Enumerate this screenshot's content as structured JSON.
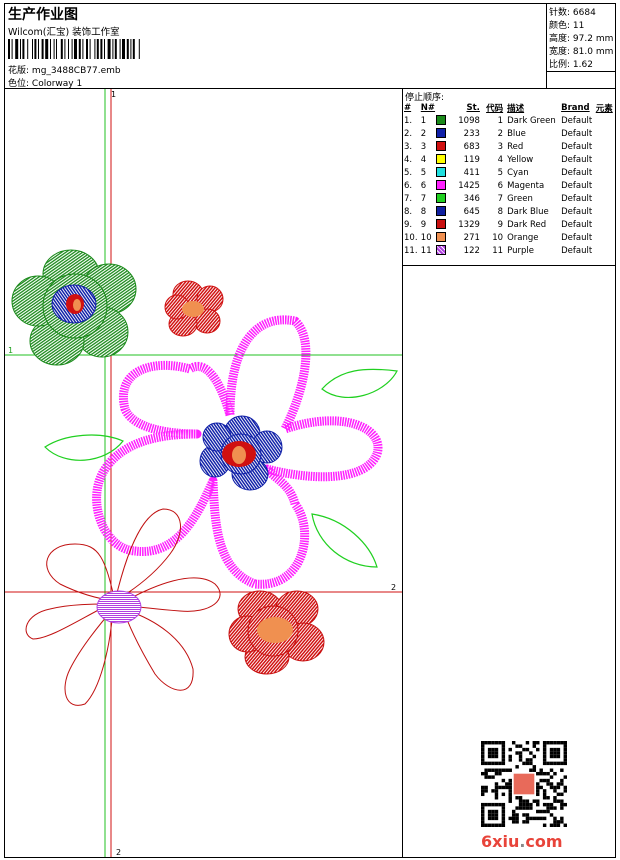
{
  "header": {
    "title": "生产作业图",
    "company": "Wilcom(汇宝) 装饰工作室",
    "design_label": "花版:",
    "design_name": "mg_3488CB77.emb",
    "colorway_label": "色位:",
    "colorway_name": "Colorway 1"
  },
  "stats": [
    {
      "label": "针数:",
      "value": "6684"
    },
    {
      "label": "颜色:",
      "value": "11"
    },
    {
      "label": "高度:",
      "value": "97.2 mm"
    },
    {
      "label": "宽度:",
      "value": "81.0 mm"
    },
    {
      "label": "比例:",
      "value": "1.62"
    }
  ],
  "stop_sequence": {
    "title": "停止顺序:",
    "headers": [
      "#",
      "N#",
      "St.",
      "代码",
      "描述",
      "Brand",
      "元素"
    ],
    "rows": [
      {
        "num": "1.",
        "n": "1",
        "color": "#1a8a1a",
        "st": "1098",
        "code": "1",
        "desc": "Dark Green",
        "brand": "Default"
      },
      {
        "num": "2.",
        "n": "2",
        "color": "#1020a8",
        "st": "233",
        "code": "2",
        "desc": "Blue",
        "brand": "Default"
      },
      {
        "num": "3.",
        "n": "3",
        "color": "#d01010",
        "st": "683",
        "code": "3",
        "desc": "Red",
        "brand": "Default"
      },
      {
        "num": "4.",
        "n": "4",
        "color": "#ffff00",
        "st": "119",
        "code": "4",
        "desc": "Yellow",
        "brand": "Default"
      },
      {
        "num": "5.",
        "n": "5",
        "color": "#20e0e0",
        "st": "411",
        "code": "5",
        "desc": "Cyan",
        "brand": "Default"
      },
      {
        "num": "6.",
        "n": "6",
        "color": "#ff20ff",
        "st": "1425",
        "code": "6",
        "desc": "Magenta",
        "brand": "Default"
      },
      {
        "num": "7.",
        "n": "7",
        "color": "#20d020",
        "st": "346",
        "code": "7",
        "desc": "Green",
        "brand": "Default"
      },
      {
        "num": "8.",
        "n": "8",
        "color": "#1020a0",
        "st": "645",
        "code": "8",
        "desc": "Dark Blue",
        "brand": "Default"
      },
      {
        "num": "9.",
        "n": "9",
        "color": "#c81010",
        "st": "1329",
        "code": "9",
        "desc": "Dark Red",
        "brand": "Default"
      },
      {
        "num": "10.",
        "n": "10",
        "color": "#f09050",
        "st": "271",
        "code": "10",
        "desc": "Orange",
        "brand": "Default"
      },
      {
        "num": "11.",
        "n": "11",
        "color": "#b040e0",
        "st": "122",
        "code": "11",
        "desc": "Purple",
        "brand": "Default"
      }
    ]
  },
  "design": {
    "marker_1_top": "1",
    "marker_1_left": "1",
    "marker_2_right": "2",
    "marker_2_bottom": "2"
  },
  "watermark": {
    "main": "6xiu",
    "dot": ".",
    "tld": "com"
  }
}
